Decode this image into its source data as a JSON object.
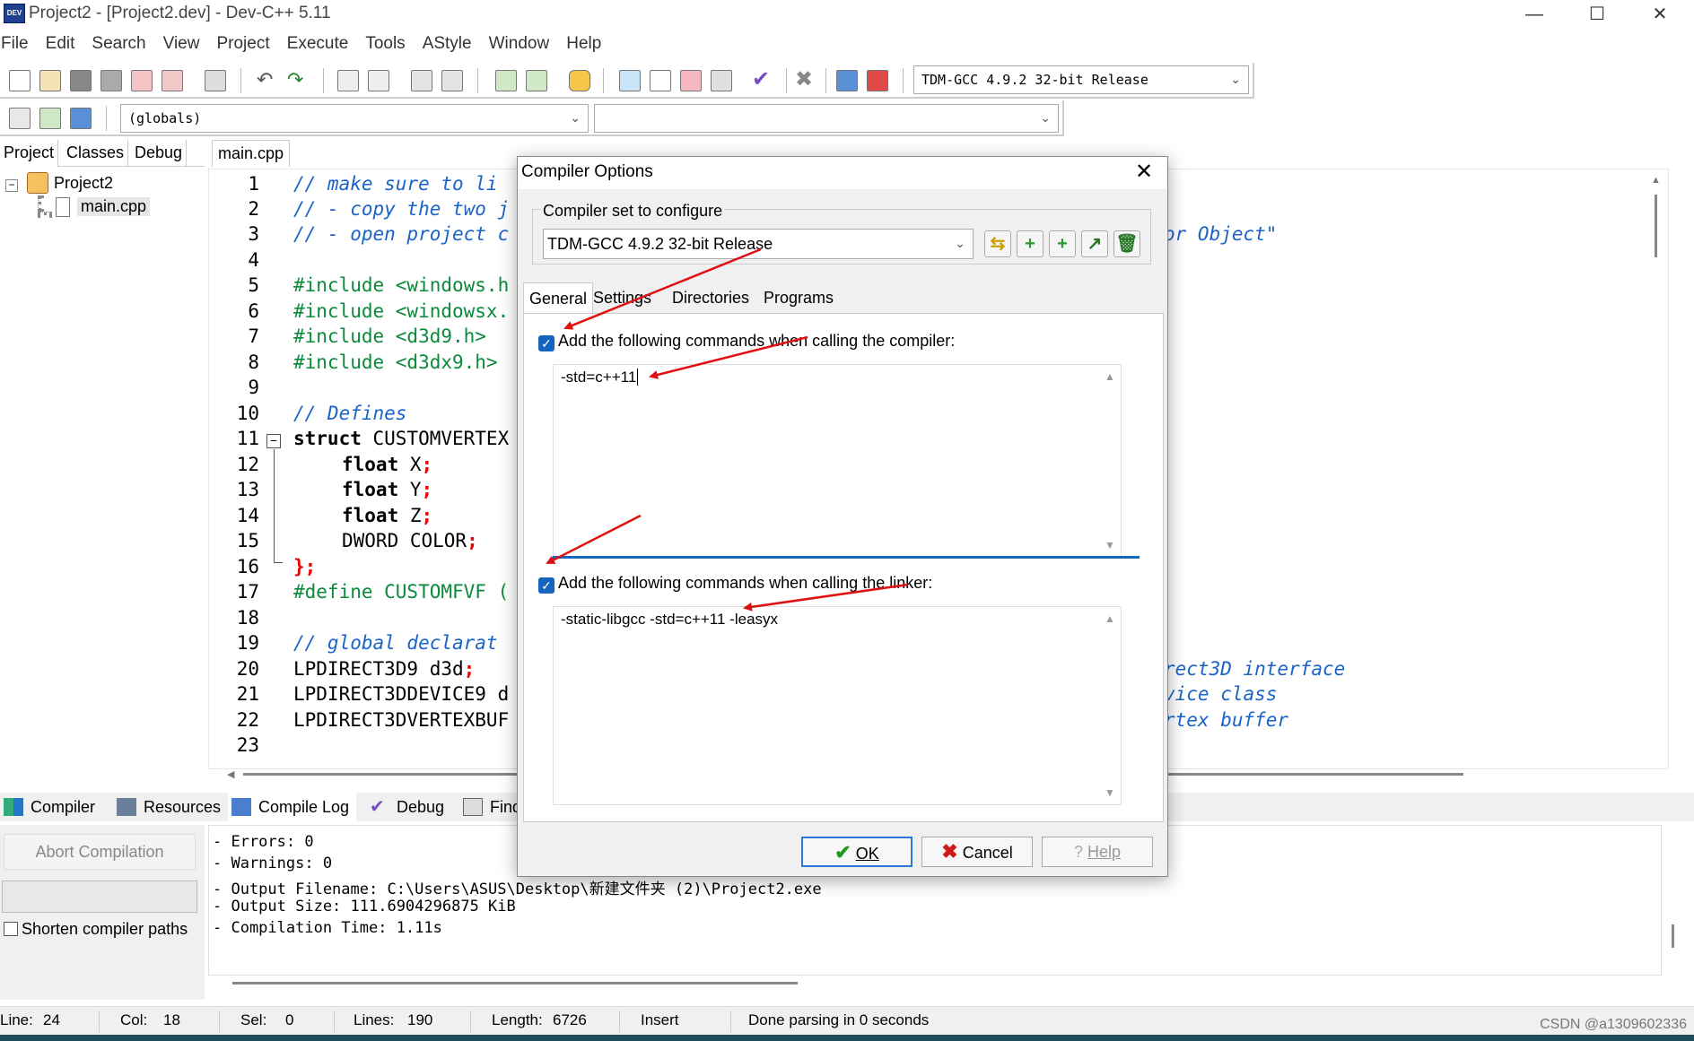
{
  "window": {
    "app_icon": "DEV",
    "title": "Project2 - [Project2.dev] - Dev-C++ 5.11",
    "minimize": "—",
    "maximize": "☐",
    "close": "✕"
  },
  "menu": [
    "File",
    "Edit",
    "Search",
    "View",
    "Project",
    "Execute",
    "Tools",
    "AStyle",
    "Window",
    "Help"
  ],
  "toolbar": {
    "compiler_select": "TDM-GCC 4.9.2 32-bit Release",
    "globals_select": "(globals)",
    "members_select": ""
  },
  "left_panel": {
    "tabs": [
      "Project",
      "Classes",
      "Debug"
    ],
    "tree": {
      "project": "Project2",
      "file": "main.cpp"
    }
  },
  "editor": {
    "tab": "main.cpp",
    "line_numbers": [
      "1",
      "2",
      "3",
      "4",
      "5",
      "6",
      "7",
      "8",
      "9",
      "10",
      "11",
      "12",
      "13",
      "14",
      "15",
      "16",
      "17",
      "18",
      "19",
      "20",
      "21",
      "22",
      "23"
    ],
    "lines": {
      "l1": "// make sure to li",
      "l2": "// - copy the two j",
      "l3": "// - open project c",
      "l3_right": "or Object\"",
      "l5": "#include <windows.h",
      "l6": "#include <windowsx.",
      "l7": "#include <d3d9.h>",
      "l8": "#include <d3dx9.h>",
      "l10": "// Defines",
      "l11_kw": "struct",
      "l11": " CUSTOMVERTEX",
      "l12_kw": "float",
      "l12": " X",
      "l13_kw": "float",
      "l13": " Y",
      "l14_kw": "float",
      "l14": " Z",
      "l15": "DWORD COLOR",
      "semicolon": ";",
      "l16": "};",
      "l17": "#define CUSTOMFVF (",
      "l19": "// global declarat",
      "l20": "LPDIRECT3D9 d3d",
      "l20_right": "rect3D interface",
      "l21": "LPDIRECT3DDEVICE9 d",
      "l21_right": "vice class",
      "l22": "LPDIRECT3DVERTEXBUF",
      "l22_right": "rtex buffer"
    }
  },
  "bottom": {
    "tabs": [
      "Compiler",
      "Resources",
      "Compile Log",
      "Debug",
      "Find"
    ],
    "abort_label": "Abort Compilation",
    "shorten_label": "Shorten compiler paths",
    "log": [
      "- Errors: 0",
      "- Warnings: 0",
      "- Output Filename: C:\\Users\\ASUS\\Desktop\\新建文件夹 (2)\\Project2.exe",
      "- Output Size: 111.6904296875 KiB",
      "- Compilation Time: 1.11s"
    ]
  },
  "status": {
    "line_label": "Line:",
    "line": "24",
    "col_label": "Col:",
    "col": "18",
    "sel_label": "Sel:",
    "sel": "0",
    "lines_label": "Lines:",
    "lines": "190",
    "length_label": "Length:",
    "length": "6726",
    "mode": "Insert",
    "message": "Done parsing in 0 seconds"
  },
  "dialog": {
    "title": "Compiler Options",
    "group_label": "Compiler set to configure",
    "compiler_set": "TDM-GCC 4.9.2 32-bit Release",
    "tabs": [
      "General",
      "Settings",
      "Directories",
      "Programs"
    ],
    "compiler_check_label": "Add the following commands when calling the compiler:",
    "compiler_commands": "-std=c++11",
    "linker_check_label": "Add the following commands when calling the linker:",
    "linker_commands": "-static-libgcc -std=c++11 -leasyx",
    "ok": "OK",
    "cancel": "Cancel",
    "help": "Help"
  },
  "watermark": "CSDN @a1309602336",
  "colors": {
    "comment": "#1a63c8",
    "preprocessor": "#0a8a3a",
    "symbol": "#e00000",
    "checkbox": "#1565c0",
    "annotation_arrow": "#e01010"
  }
}
